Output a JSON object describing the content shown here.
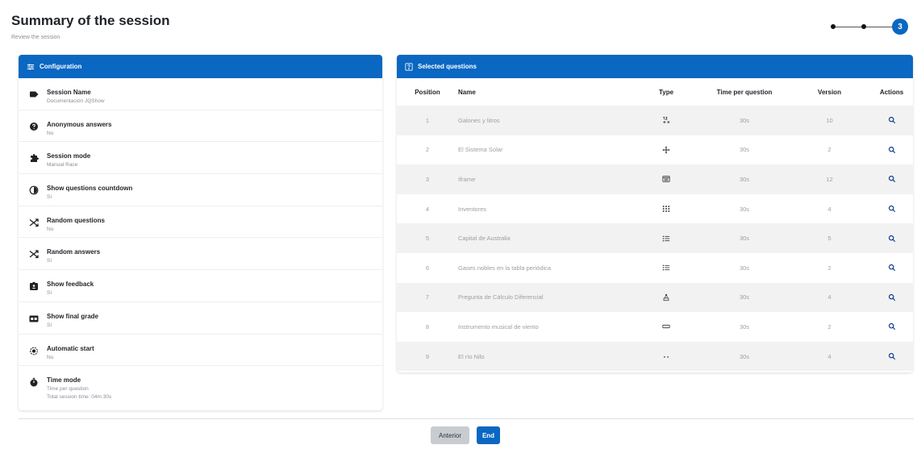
{
  "page": {
    "title": "Summary of the session",
    "subtitle": "Review the session"
  },
  "stepper": {
    "current_step": "3",
    "total_steps": 3
  },
  "config": {
    "header": "Configuration",
    "items": [
      {
        "label": "Session Name",
        "value": "Documentación JQShow",
        "icon": "tag-icon"
      },
      {
        "label": "Anonymous answers",
        "value": "No",
        "icon": "question-circle-icon"
      },
      {
        "label": "Session mode",
        "value": "Manual Race",
        "icon": "puzzle-icon"
      },
      {
        "label": "Show questions countdown",
        "value": "Sí",
        "icon": "clock-half-icon"
      },
      {
        "label": "Random questions",
        "value": "No",
        "icon": "shuffle-icon"
      },
      {
        "label": "Random answers",
        "value": "Sí",
        "icon": "shuffle-icon"
      },
      {
        "label": "Show feedback",
        "value": "Sí",
        "icon": "feedback-icon"
      },
      {
        "label": "Show final grade",
        "value": "Sí",
        "icon": "grade-icon"
      },
      {
        "label": "Automatic start",
        "value": "No",
        "icon": "autostart-icon"
      },
      {
        "label": "Time mode",
        "value": "Time per question",
        "value2": "Total session time: 04m 30s",
        "icon": "stopwatch-icon"
      }
    ]
  },
  "questions": {
    "header": "Selected questions",
    "columns": {
      "position": "Position",
      "name": "Name",
      "type": "Type",
      "time": "Time per question",
      "version": "Version",
      "actions": "Actions"
    },
    "rows": [
      {
        "position": "1",
        "name": "Galones y litros",
        "type_icon": "numeric-type-icon",
        "time": "30s",
        "version": "10"
      },
      {
        "position": "2",
        "name": "El Sistema Solar",
        "type_icon": "drag-type-icon",
        "time": "30s",
        "version": "2"
      },
      {
        "position": "3",
        "name": "Iframe",
        "type_icon": "iframe-type-icon",
        "time": "30s",
        "version": "12"
      },
      {
        "position": "4",
        "name": "Inventores",
        "type_icon": "grid-type-icon",
        "time": "30s",
        "version": "4"
      },
      {
        "position": "5",
        "name": "Capital de Australia",
        "type_icon": "list-type-icon",
        "time": "30s",
        "version": "5"
      },
      {
        "position": "6",
        "name": "Gases nobles en la tabla periódica",
        "type_icon": "list-type-icon",
        "time": "30s",
        "version": "2"
      },
      {
        "position": "7",
        "name": "Pregunta de Cálculo Diferencial",
        "type_icon": "calc-type-icon",
        "time": "30s",
        "version": "4"
      },
      {
        "position": "8",
        "name": "Instrumento musical de viento",
        "type_icon": "input-type-icon",
        "time": "30s",
        "version": "2"
      },
      {
        "position": "9",
        "name": "El río Nilo",
        "type_icon": "dots-type-icon",
        "time": "30s",
        "version": "4"
      }
    ]
  },
  "footer": {
    "prev_label": "Anterior",
    "end_label": "End"
  },
  "colors": {
    "accent": "#0a67c2",
    "row_alt": "#f2f2f2",
    "muted_text": "#9aa0a6"
  }
}
